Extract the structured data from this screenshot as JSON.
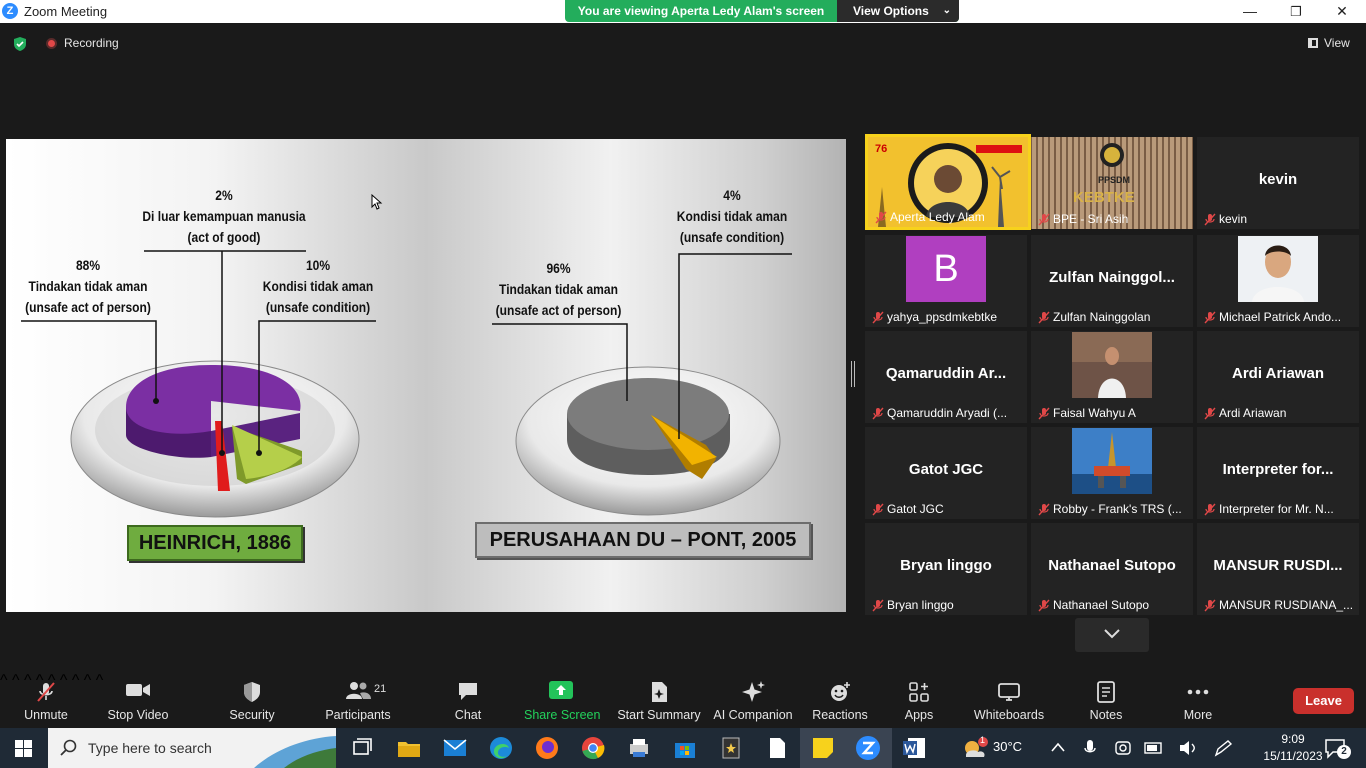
{
  "window": {
    "app_title": "Zoom Meeting",
    "viewing_banner": "You are viewing Aperta Ledy Alam's screen",
    "view_options": "View Options",
    "minimize": "—",
    "restore": "❐",
    "close": "✕"
  },
  "topbar": {
    "recording": "Recording",
    "view": "View"
  },
  "slide": {
    "heinrich": {
      "title": "HEINRICH, 1886",
      "label_2": [
        "2%",
        "Di luar kemampuan manusia",
        "(act of good)"
      ],
      "label_88": [
        "88%",
        "Tindakan tidak aman",
        "(unsafe act of person)"
      ],
      "label_10": [
        "10%",
        "Kondisi tidak aman",
        "(unsafe condition)"
      ]
    },
    "dupont": {
      "title": "PERUSAHAAN DU – PONT, 2005",
      "label_96": [
        "96%",
        "Tindakan tidak aman",
        "(unsafe act of person)"
      ],
      "label_4": [
        "4%",
        "Kondisi tidak aman",
        "(unsafe condition)"
      ]
    }
  },
  "gallery": [
    {
      "big": "",
      "label": "Aperta Ledy Alam",
      "active": true
    },
    {
      "big": "",
      "label": "BPE - Sri Asih"
    },
    {
      "big": "kevin",
      "label": "kevin"
    },
    {
      "big": "B",
      "label": "yahya_ppsdmkebtke"
    },
    {
      "big": "Zulfan  Nainggol...",
      "label": "Zulfan Nainggolan"
    },
    {
      "big": "",
      "label": "Michael Patrick Ando..."
    },
    {
      "big": "Qamaruddin  Ar...",
      "label": "Qamaruddin Aryadi (..."
    },
    {
      "big": "",
      "label": "Faisal Wahyu A"
    },
    {
      "big": "Ardi Ariawan",
      "label": "Ardi Ariawan"
    },
    {
      "big": "Gatot JGC",
      "label": "Gatot JGC"
    },
    {
      "big": "",
      "label": "Robby - Frank's TRS (..."
    },
    {
      "big": "Interpreter  for...",
      "label": "Interpreter for Mr. N..."
    },
    {
      "big": "Bryan linggo",
      "label": "Bryan linggo"
    },
    {
      "big": "Nathanael Sutopo",
      "label": "Nathanael Sutopo"
    },
    {
      "big": "MANSUR  RUSDI...",
      "label": "MANSUR RUSDIANA_..."
    }
  ],
  "gallery_extra": {
    "slide_logo_text": "76",
    "bpe_sign": "KEBTKE",
    "bpe_top": "PPSDM"
  },
  "toolbar": {
    "unmute": "Unmute",
    "stop_video": "Stop Video",
    "security": "Security",
    "participants": "Participants",
    "participants_count": "21",
    "chat": "Chat",
    "share_screen": "Share Screen",
    "start_summary": "Start Summary",
    "ai_companion": "AI Companion",
    "reactions": "Reactions",
    "apps": "Apps",
    "whiteboards": "Whiteboards",
    "notes": "Notes",
    "more": "More",
    "leave": "Leave"
  },
  "taskbar": {
    "search_placeholder": "Type here to search",
    "temperature": "30°C",
    "time": "9:09",
    "date": "15/11/2023",
    "notifications": "2",
    "weather_badge": "1"
  },
  "colors": {
    "zoom_blue": "#2d8cff",
    "banner_green": "#23ad5c",
    "active_border": "#f7d21c",
    "leave_red": "#c9302c",
    "pie_purple": "#7b2fa3",
    "pie_green": "#b5cf4a",
    "pie_red": "#e01c1c",
    "pie_gray": "#7c7c7c",
    "pie_orange": "#f2b300"
  }
}
